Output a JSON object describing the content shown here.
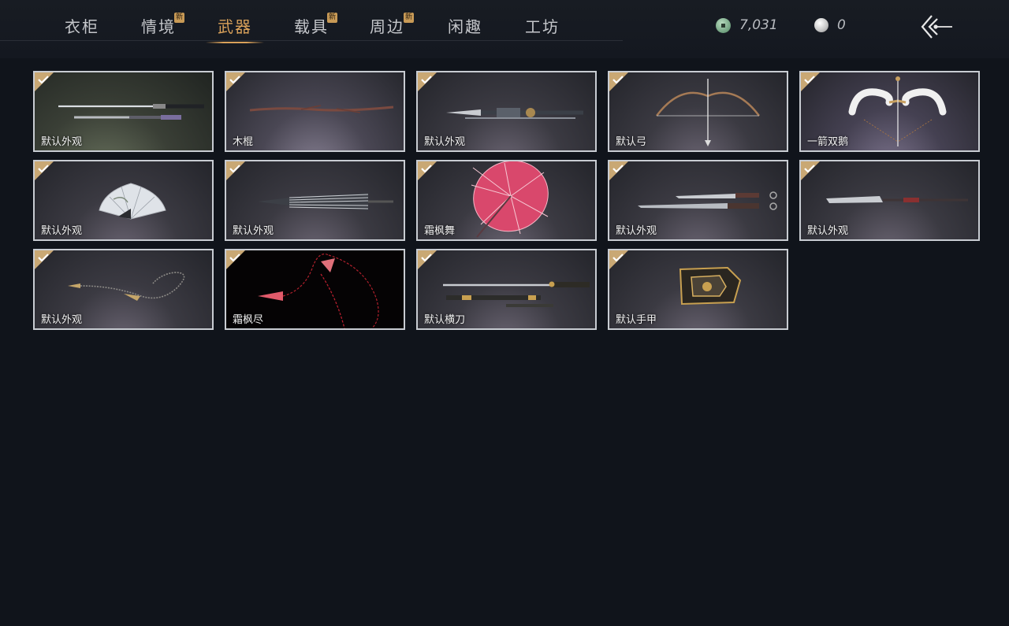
{
  "tabs": [
    {
      "label": "衣柜",
      "badge": ""
    },
    {
      "label": "情境",
      "badge": "新"
    },
    {
      "label": "武器",
      "badge": ""
    },
    {
      "label": "载具",
      "badge": "新"
    },
    {
      "label": "周边",
      "badge": "新"
    },
    {
      "label": "闲趣",
      "badge": ""
    },
    {
      "label": "工坊",
      "badge": ""
    }
  ],
  "active_tab": "武器",
  "currency": {
    "jade_amount": "7,031",
    "pearl_amount": "0"
  },
  "items": [
    {
      "name": "默认外观",
      "icon": "double-sword-icon",
      "equipped": true
    },
    {
      "name": "木棍",
      "icon": "wooden-staff-icon",
      "equipped": true
    },
    {
      "name": "默认外观",
      "icon": "spear-icon",
      "equipped": true
    },
    {
      "name": "默认弓",
      "icon": "bow-icon",
      "equipped": true
    },
    {
      "name": "一箭双鹅",
      "icon": "swan-bow-icon",
      "equipped": true
    },
    {
      "name": "默认外观",
      "icon": "fan-icon",
      "equipped": true
    },
    {
      "name": "默认外观",
      "icon": "closed-umbrella-icon",
      "equipped": true
    },
    {
      "name": "霜枫舞",
      "icon": "pink-umbrella-icon",
      "equipped": true
    },
    {
      "name": "默认外观",
      "icon": "twin-blades-icon",
      "equipped": true
    },
    {
      "name": "默认外观",
      "icon": "long-blade-icon",
      "equipped": true
    },
    {
      "name": "默认外观",
      "icon": "rope-dart-icon",
      "equipped": true
    },
    {
      "name": "霜枫尽",
      "icon": "red-rope-dart-icon",
      "equipped": true
    },
    {
      "name": "默认横刀",
      "icon": "hengdao-icon",
      "equipped": true
    },
    {
      "name": "默认手甲",
      "icon": "gauntlet-icon",
      "equipped": true
    }
  ],
  "colors": {
    "background": "#10141b",
    "active_tab": "#d9a15a",
    "badge": "#c89a56",
    "check": "#c9a874",
    "card_border": "#c8ccd2"
  }
}
